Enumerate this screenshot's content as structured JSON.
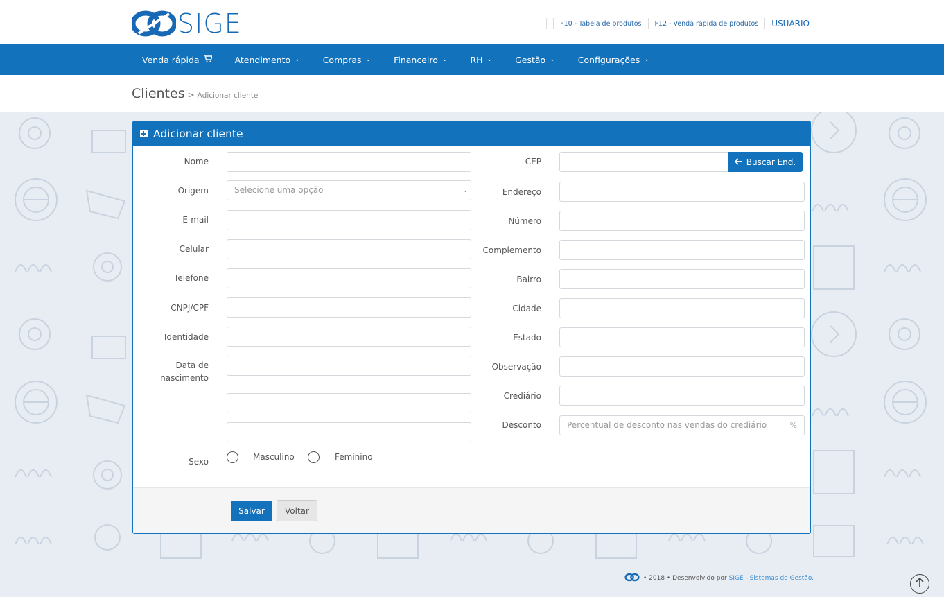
{
  "brand": {
    "name": "SIGE"
  },
  "header": {
    "shortcut_f10": "F10 - Tabela de produtos",
    "shortcut_f12": "F12 - Venda rápida de produtos",
    "user": "USUARIO"
  },
  "nav": {
    "items": [
      {
        "label": "Venda rápida",
        "icon": "cart-icon"
      },
      {
        "label": "Atendimento",
        "icon": "chevron-down-icon"
      },
      {
        "label": "Compras",
        "icon": "chevron-down-icon"
      },
      {
        "label": "Financeiro",
        "icon": "chevron-down-icon"
      },
      {
        "label": "RH",
        "icon": "chevron-down-icon"
      },
      {
        "label": "Gestão",
        "icon": "chevron-down-icon"
      },
      {
        "label": "Configurações",
        "icon": "chevron-down-icon"
      }
    ]
  },
  "breadcrumb": {
    "title": "Clientes",
    "separator": ">",
    "current": "Adicionar cliente"
  },
  "panel": {
    "title": "Adicionar cliente"
  },
  "form": {
    "left": {
      "nome": "Nome",
      "origem": "Origem",
      "origem_placeholder": "Selecione uma opção",
      "email": "E-mail",
      "celular": "Celular",
      "telefone": "Telefone",
      "cnpj": "CNPJ/CPF",
      "identidade": "Identidade",
      "nascimento_1": "Data de",
      "nascimento_2": "nascimento",
      "sexo": "Sexo",
      "masculino": "Masculino",
      "feminino": "Feminino"
    },
    "right": {
      "cep": "CEP",
      "buscar": "Buscar End.",
      "endereco": "Endereço",
      "numero": "Número",
      "complemento": "Complemento",
      "bairro": "Bairro",
      "cidade": "Cidade",
      "estado": "Estado",
      "observacao": "Observação",
      "crediario": "Crediário",
      "desconto": "Desconto",
      "desconto_placeholder": "Percentual de desconto nas vendas do crediário",
      "desconto_unit": "%"
    }
  },
  "actions": {
    "save": "Salvar",
    "back": "Voltar"
  },
  "footer": {
    "text": "• 2018 • Desenvolvido por",
    "link": "SIGE - Sistemas de Gestão."
  },
  "colors": {
    "primary": "#1372bc",
    "background": "#e8edf3"
  }
}
